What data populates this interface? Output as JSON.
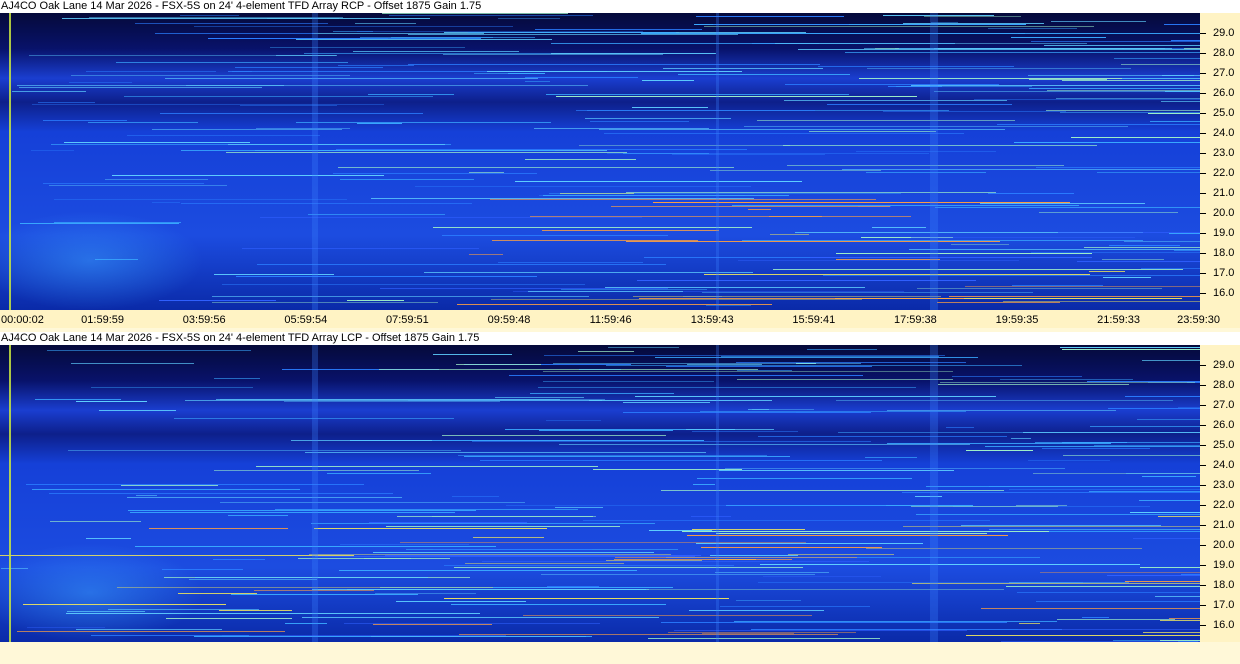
{
  "panels": [
    {
      "id": "rcp",
      "title": "AJ4CO Oak Lane 14 Mar 2026 - FSX-5S on 24' 4-element TFD Array RCP  -  Offset 1875  Gain 1.75"
    },
    {
      "id": "lcp",
      "title": "AJ4CO Oak Lane 14 Mar 2026 - FSX-5S on 24' 4-element TFD Array LCP  -  Offset 1875  Gain 1.75"
    }
  ],
  "frequency_labels": [
    "29.0",
    "28.0",
    "27.0",
    "26.0",
    "25.0",
    "24.0",
    "23.0",
    "22.0",
    "21.0",
    "20.0",
    "19.0",
    "18.0",
    "17.0",
    "16.0"
  ],
  "time_labels": [
    "00:00:02",
    "01:59:59",
    "03:59:56",
    "05:59:54",
    "07:59:51",
    "09:59:48",
    "11:59:46",
    "13:59:43",
    "15:59:41",
    "17:59:38",
    "19:59:35",
    "21:59:33",
    "23:59:30"
  ],
  "colors": {
    "background": "#fff8d8",
    "axis_background": "#fff3c4",
    "spectrogram_base": "#1540d8",
    "spectrogram_dark": "#050a3a",
    "spectrogram_bright": "#3aa0ff",
    "marker": "#c9e840"
  }
}
